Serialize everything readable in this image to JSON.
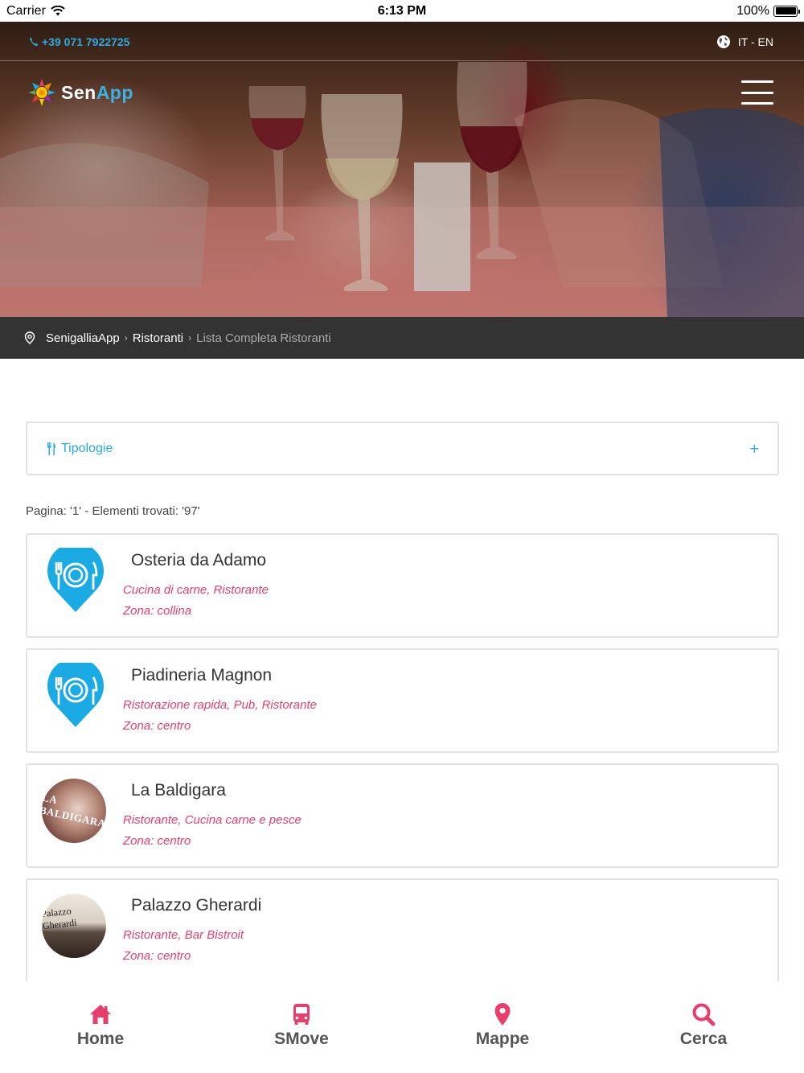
{
  "status_bar": {
    "carrier": "Carrier",
    "time": "6:13 PM",
    "battery": "100%",
    "battery_level": 1.0
  },
  "header": {
    "phone": "+39 071 7922725",
    "languages": "IT - EN",
    "logo_part1": "Sen",
    "logo_part2": "App"
  },
  "breadcrumb": {
    "home": "SenigalliaApp",
    "section": "Ristoranti",
    "current": "Lista Completa Ristoranti"
  },
  "filter": {
    "label": "Tipologie",
    "toggle": "+"
  },
  "page_info": "Pagina: '1' - Elementi trovati: '97'",
  "restaurants": [
    {
      "name": "Osteria da Adamo",
      "types": "Cucina di carne, Ristorante",
      "zone": "Zona: collina",
      "icon": "restaurant-pin-icon"
    },
    {
      "name": "Piadineria Magnon",
      "types": "Ristorazione rapida, Pub, Ristorante",
      "zone": "Zona: centro",
      "icon": "restaurant-pin-icon"
    },
    {
      "name": "La Baldigara",
      "types": "Ristorante, Cucina carne e pesce",
      "zone": "Zona: centro",
      "photo_text": "LA BALDIGARA"
    },
    {
      "name": "Palazzo Gherardi",
      "types": "Ristorante, Bar Bistroit",
      "zone": "Zona: centro",
      "photo_text": "Palazzo Gherardi"
    }
  ],
  "tabs": [
    {
      "label": "Home",
      "icon": "home-icon"
    },
    {
      "label": "SMove",
      "icon": "bus-icon"
    },
    {
      "label": "Mappe",
      "icon": "map-pin-icon"
    },
    {
      "label": "Cerca",
      "icon": "search-icon"
    }
  ],
  "colors": {
    "accent_blue": "#2aaae0",
    "accent_pink": "#e83e6d",
    "breadcrumb_bg": "#333333"
  }
}
